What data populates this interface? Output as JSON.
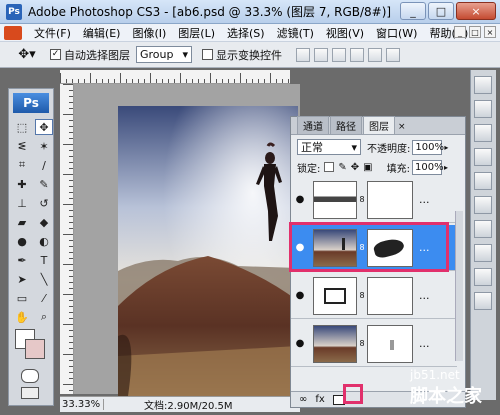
{
  "window": {
    "title": "Adobe Photoshop CS3 - [ab6.psd @ 33.3% (图层 7, RGB/8#)]",
    "logo_text": "Ps",
    "controls": [
      "_",
      "□",
      "×"
    ]
  },
  "menu": {
    "items": [
      "文件(F)",
      "编辑(E)",
      "图像(I)",
      "图层(L)",
      "选择(S)",
      "滤镜(T)",
      "视图(V)",
      "窗口(W)",
      "帮助(H)"
    ],
    "right_controls": [
      "_",
      "□",
      "×"
    ]
  },
  "options": {
    "auto_select_label": "自动选择图层",
    "auto_select_checked": true,
    "group_value": "Group",
    "show_transform_label": "显示变换控件",
    "show_transform_checked": false
  },
  "toolbox": {
    "logo_text": "Ps"
  },
  "status": {
    "zoom": "33.33%",
    "doc": "文档:2.90M/20.5M"
  },
  "layers_panel": {
    "tabs": [
      "通道",
      "路径",
      "图层"
    ],
    "active_tab": "图层",
    "blend_mode": "正常",
    "opacity_label": "不透明度:",
    "opacity_value": "100%",
    "lock_label": "锁定:",
    "fill_label": "填充:",
    "fill_value": "100%",
    "rows": [
      {
        "dots": "..."
      },
      {
        "dots": "...",
        "selected": true
      },
      {
        "dots": "..."
      },
      {
        "dots": "..."
      }
    ]
  },
  "watermark": {
    "line1": "jb51.net",
    "line2": "脚本之家"
  },
  "colors": {
    "highlight": "#e1306c",
    "selected_layer": "#3c8cf0"
  }
}
